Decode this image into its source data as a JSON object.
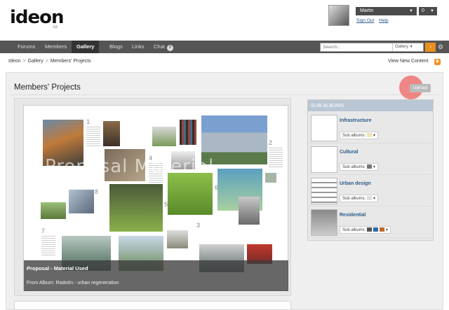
{
  "brand": {
    "logo": "ideon",
    "sub": "cz"
  },
  "user": {
    "name": "Martin",
    "notifications": "0",
    "sign_out": "Sign Out",
    "help": "Help"
  },
  "nav": {
    "items": [
      "Forums",
      "Members",
      "Gallery",
      "Blogs",
      "Links",
      "Chat"
    ],
    "active": "Gallery",
    "chat_count": "0"
  },
  "search": {
    "placeholder": "Search...",
    "scope": "Gallery"
  },
  "breadcrumb": {
    "items": [
      "Ideon",
      "Gallery",
      "Members' Projects"
    ]
  },
  "view_new": "View New Content",
  "page": {
    "title": "Members' Projects",
    "upload": "Upload"
  },
  "featured": {
    "title": "Proposal - Material Used",
    "from_album": "From Album: Radotín - urban regeneration",
    "watermark": "Proposal Material"
  },
  "sub_albums": {
    "header": "SUB ALBUMS",
    "label": "Sub albums:",
    "items": [
      {
        "name": "Infrastructure"
      },
      {
        "name": "Cultural"
      },
      {
        "name": "Urban design"
      },
      {
        "name": "Residential"
      }
    ]
  },
  "colors": {
    "accent": "#e8901f",
    "nav_bg": "#555555",
    "link": "#2a5a8a",
    "sub_header": "#b9c6d3"
  }
}
